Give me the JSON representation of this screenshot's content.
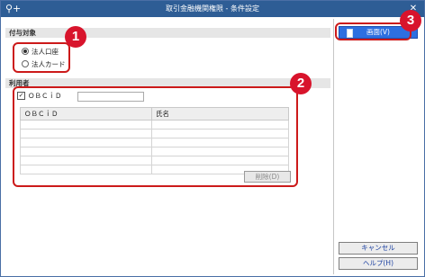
{
  "window": {
    "title": "取引金融機関権限 - 条件設定",
    "app_icon": "key-plus-icon",
    "close_label": "✕"
  },
  "section_target": {
    "header": "付与対象",
    "options": [
      {
        "label": "法人口座",
        "selected": true
      },
      {
        "label": "法人カード",
        "selected": false
      }
    ]
  },
  "section_users": {
    "header": "利用者",
    "checkbox_label": "ＯＢＣｉＤ",
    "checkbox_checked": true,
    "input_value": "",
    "table_headers": [
      "ＯＢＣｉＤ",
      "氏名"
    ],
    "rows": [
      [
        "",
        ""
      ],
      [
        "",
        ""
      ],
      [
        "",
        ""
      ],
      [
        "",
        ""
      ],
      [
        "",
        ""
      ],
      [
        "",
        ""
      ]
    ],
    "delete_label": "削除(D)"
  },
  "side": {
    "screen_label": "画面(V)",
    "cancel_label": "キャンセル",
    "help_label": "ヘルプ(H)"
  },
  "callouts": [
    "1",
    "2",
    "3"
  ],
  "colors": {
    "title_bar": "#2e5d95",
    "callout_red": "#d8142c",
    "primary_button": "#2d6fe0"
  }
}
